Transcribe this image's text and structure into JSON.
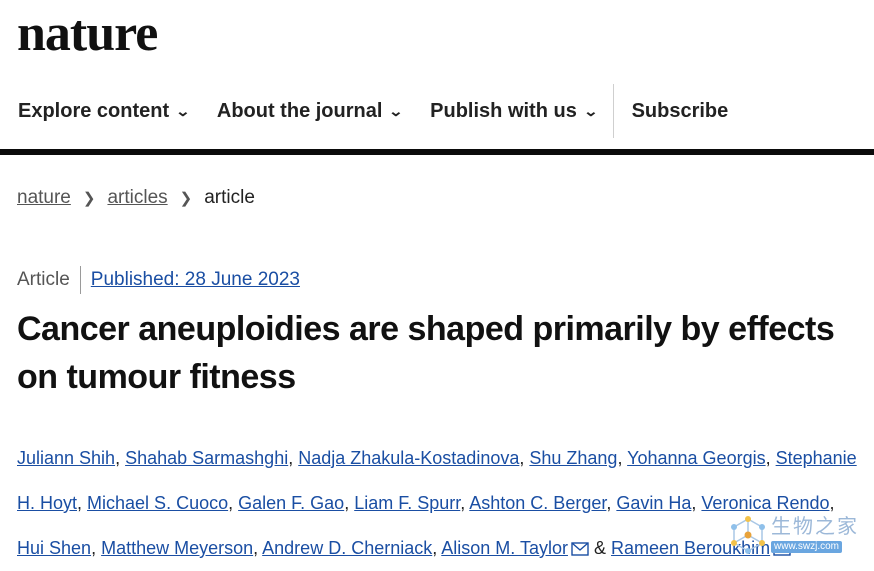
{
  "brand": {
    "logo_text": "nature"
  },
  "nav": {
    "items": [
      {
        "label": "Explore content"
      },
      {
        "label": "About the journal"
      },
      {
        "label": "Publish with us"
      }
    ],
    "subscribe_label": "Subscribe"
  },
  "breadcrumb": {
    "items": [
      "nature",
      "articles"
    ],
    "current": "article"
  },
  "article": {
    "type": "Article",
    "published": "Published: 28 June 2023",
    "title": "Cancer aneuploidies are shaped primarily by effects on tumour fitness",
    "authors": [
      "Juliann Shih",
      "Shahab Sarmashghi",
      "Nadja Zhakula-Kostadinova",
      "Shu Zhang",
      "Yohanna Georgis",
      "Stephanie H. Hoyt",
      "Michael S. Cuoco",
      "Galen F. Gao",
      "Liam F. Spurr",
      "Ashton C. Berger",
      "Gavin Ha",
      "Veronica Rendo",
      "Hui Shen",
      "Matthew Meyerson",
      "Andrew D. Cherniack",
      "Alison M. Taylor"
    ],
    "ampersand": "&",
    "last_author": "Rameen Beroukhim"
  },
  "watermark": {
    "cn": "生物之家",
    "url": "www.swzj.com"
  },
  "colors": {
    "link": "#1a4ea3",
    "rule": "#0b0b0b"
  }
}
